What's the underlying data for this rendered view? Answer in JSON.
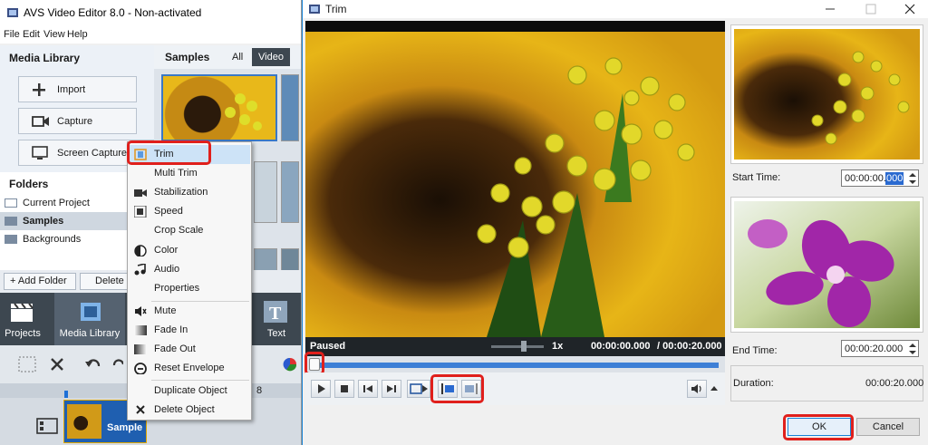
{
  "main_window": {
    "title": "AVS Video Editor 8.0 - Non-activated",
    "menu": [
      "File",
      "Edit",
      "View",
      "Help"
    ],
    "media_library_label": "Media Library",
    "buttons": {
      "import": "Import",
      "capture": "Capture",
      "screen_capture": "Screen Capture"
    },
    "samples_label": "Samples",
    "filter_tabs": {
      "all": "All",
      "video": "Video"
    },
    "folders_label": "Folders",
    "folders": [
      "Current Project",
      "Samples",
      "Backgrounds"
    ],
    "add_folder": "+ Add Folder",
    "delete_folder": "Delete F",
    "toolbar": {
      "projects": "Projects",
      "media_library": "Media Library",
      "text": "Text"
    },
    "timeline_clip_label": "Sample",
    "timeline_number": "8"
  },
  "context_menu": {
    "items": [
      "Trim",
      "Multi Trim",
      "Stabilization",
      "Speed",
      "Crop Scale",
      "Color",
      "Audio",
      "Properties",
      "Mute",
      "Fade In",
      "Fade Out",
      "Reset Envelope",
      "Duplicate Object",
      "Delete Object"
    ]
  },
  "trim_dialog": {
    "title": "Trim",
    "status": "Paused",
    "speed": "1x",
    "current_time": "00:00:00.000",
    "total_time": "/ 00:00:20.000",
    "start_time_label": "Start Time:",
    "start_time_main": "00:00:00.",
    "start_time_selected": "000",
    "end_time_label": "End Time:",
    "end_time_value": "00:00:20.000",
    "duration_label": "Duration:",
    "duration_value": "00:00:20.000",
    "ok": "OK",
    "cancel": "Cancel"
  },
  "colors": {
    "accent": "#1883d7",
    "highlight": "#e0201c",
    "toolbar_dark": "#3d4750"
  }
}
